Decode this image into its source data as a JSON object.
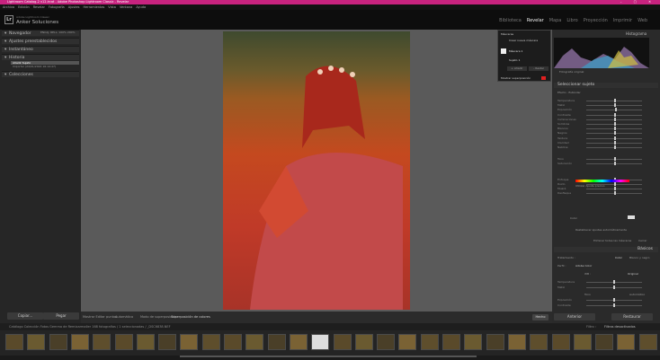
{
  "window": {
    "title": "Lightroom Catalog-2 v12.lrcat - Adobe Photoshop Lightroom Classic - Revelar",
    "controls": "– ▢ ✕"
  },
  "menu": [
    "Archivo",
    "Edición",
    "Revelar",
    "Fotografía",
    "Ajustes",
    "Herramientas",
    "Vista",
    "Ventana",
    "Ayuda"
  ],
  "identity": {
    "logo": "Lr",
    "small": "Adobe Lightroom Classic",
    "name": "Anker Soluciones"
  },
  "modules": [
    "Biblioteca",
    "Revelar",
    "Mapa",
    "Libro",
    "Proyección",
    "Imprimir",
    "Web"
  ],
  "active_module": "Revelar",
  "left_panel": {
    "navigator": "Navegador",
    "nav_tabs": "ENCAJ. RELL. 100% 200%",
    "presets": "Ajustes preestablecidos",
    "snapshots": "Instantáneo",
    "history": "Historia",
    "history_items": [
      "Añadir Sujeto",
      "Importar (24/01/2024 16:14:47)"
    ],
    "collections": "Colecciones",
    "copy_btn": "Copiar...",
    "paste_btn": "Pegar"
  },
  "toolbar": {
    "mask_label": "Mostrar Editar puntos",
    "auto": "Automático",
    "overlay_mode": "Modo de superposición :",
    "overlay_value": "Superposición de colores",
    "done": "Hecho"
  },
  "masks": {
    "title": "Máscaras",
    "create": "Crear nueva máscara",
    "mask1": "Máscara 1",
    "subject": "Sujeto 1",
    "add": "+ Añadir",
    "subtract": "– Restar",
    "show_overlay": "Mostrar superposición"
  },
  "histogram": {
    "title": "Histograma",
    "info": "Fotografía original"
  },
  "right_panel": {
    "mask_select": "Seleccionar sujeto",
    "effect": "Efecto : Estándar",
    "sliders": [
      {
        "label": "Temperatura",
        "knob": 0.5
      },
      {
        "label": "Matiz",
        "knob": 0.5
      },
      {
        "label": "Exposición",
        "knob": 0.52
      },
      {
        "label": "Contraste",
        "knob": 0.5
      },
      {
        "label": "Iluminaciones",
        "knob": 0.5
      },
      {
        "label": "Sombras",
        "knob": 0.5
      },
      {
        "label": "Blancos",
        "knob": 0.5
      },
      {
        "label": "Negros",
        "knob": 0.5
      },
      {
        "label": "Textura",
        "knob": 0.5
      },
      {
        "label": "Claridad",
        "knob": 0.5
      },
      {
        "label": "Neblina",
        "knob": 0.5
      },
      {
        "label": "Tono",
        "knob": 0.5
      },
      {
        "label": "Saturación",
        "knob": 0.5
      },
      {
        "label": "Enfoque",
        "knob": 0.5
      },
      {
        "label": "Ruido",
        "knob": 0.5
      },
      {
        "label": "Muaré",
        "knob": 0.5
      },
      {
        "label": "Desfleque",
        "knob": 0.5
      }
    ],
    "use_precise": "Utilizar Ajuste preciso",
    "color": "Color",
    "auto_mask": "Restablecer ajustes automáticamente",
    "delete_all": "Eliminar todas las máscaras",
    "close": "Cerrar",
    "basic": "Básicos",
    "treatment": "Tratamiento :",
    "color_opt": "Color",
    "bw_opt": "Blanco y negro",
    "profile": "Perfil :",
    "profile_val": "Adobe Color",
    "wb": "WB :",
    "wb_val": "Original",
    "temp": "Temperatura",
    "tint": "Matiz",
    "tone": "Tono",
    "tone_auto": "Automático",
    "exposure": "Exposición",
    "contrast": "Contraste",
    "prev_btn": "Anterior",
    "reset_btn": "Restaurar"
  },
  "filmstrip": {
    "info": "Catálogo   Colección Fotos Gemma de Remixarmaller   168 fotografías / 1 seleccionadas / _DSC6838.NEF",
    "filter": "Filtro :",
    "filter_val": "Filtros desactivados",
    "thumbs": 30,
    "selected_index": 14
  }
}
